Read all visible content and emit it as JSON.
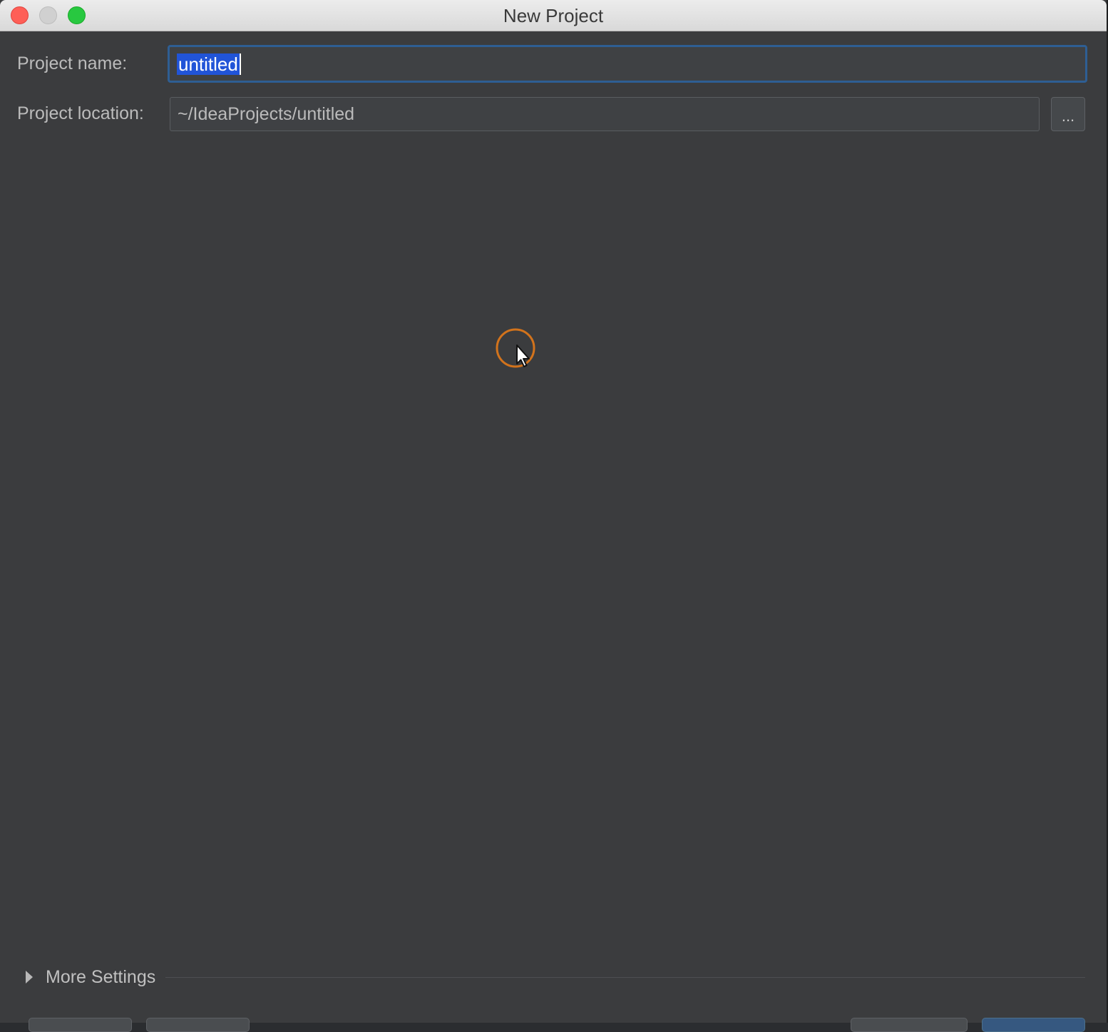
{
  "window": {
    "title": "New Project"
  },
  "form": {
    "project_name_label": "Project name:",
    "project_name_value": "untitled",
    "project_location_label": "Project location:",
    "project_location_value": "~/IdeaProjects/untitled",
    "browse_label": "..."
  },
  "more_settings": {
    "label": "More Settings",
    "expanded": false
  },
  "icons": {
    "close": "close-traffic-light",
    "minimize": "minimize-traffic-light",
    "zoom": "zoom-traffic-light",
    "expand": "triangle-right-icon",
    "cursor": "mouse-pointer-icon"
  },
  "colors": {
    "background": "#3b3c3e",
    "selection": "#2154d8",
    "focus_border": "#2e5e93",
    "cursor_ring": "#d2731c"
  }
}
